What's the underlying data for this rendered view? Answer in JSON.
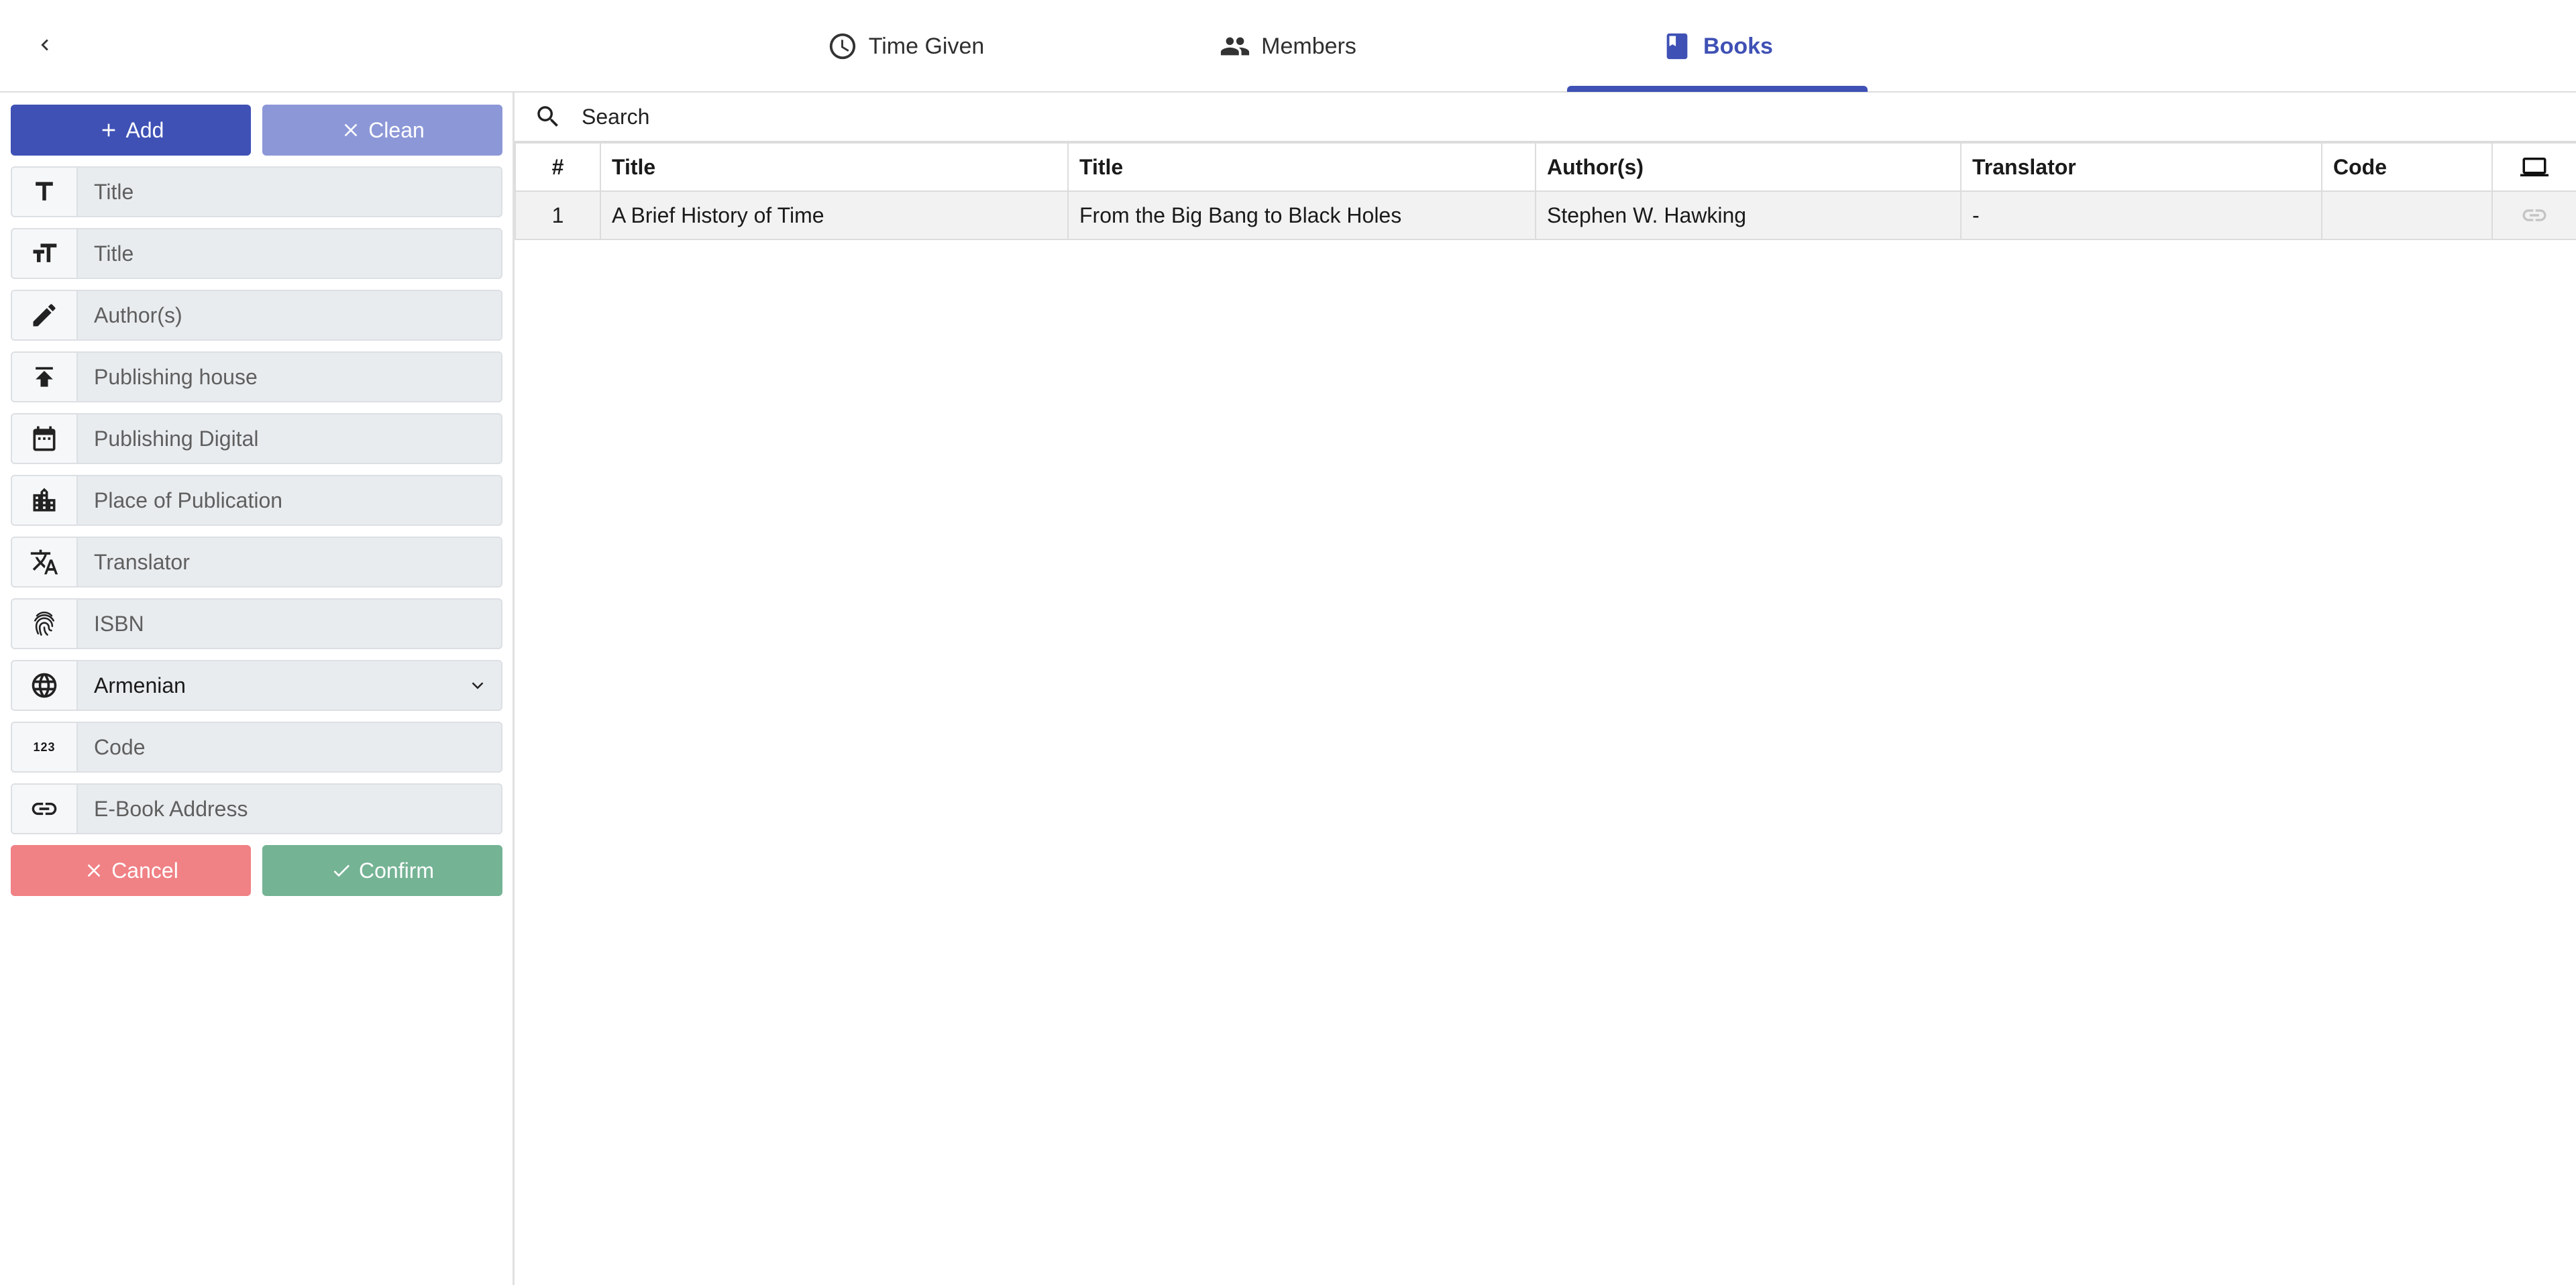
{
  "header": {
    "tabs": [
      {
        "label": "Time Given",
        "icon": "clock-icon",
        "active": false
      },
      {
        "label": "Members",
        "icon": "people-icon",
        "active": false
      },
      {
        "label": "Books",
        "icon": "book-icon",
        "active": true
      }
    ],
    "accent_color": "#3f51b5"
  },
  "form": {
    "add_label": "Add",
    "clean_label": "Clean",
    "cancel_label": "Cancel",
    "confirm_label": "Confirm",
    "fields": [
      {
        "placeholder": "Title",
        "icon": "text-title-icon"
      },
      {
        "placeholder": "Title",
        "icon": "text-size-icon"
      },
      {
        "placeholder": "Author(s)",
        "icon": "pencil-icon"
      },
      {
        "placeholder": "Publishing house",
        "icon": "publish-icon"
      },
      {
        "placeholder": "Publishing Digital",
        "icon": "calendar-icon"
      },
      {
        "placeholder": "Place of Publication",
        "icon": "city-icon"
      },
      {
        "placeholder": "Translator",
        "icon": "translate-icon"
      },
      {
        "placeholder": "ISBN",
        "icon": "fingerprint-icon"
      }
    ],
    "language": {
      "value": "Armenian",
      "icon": "globe-icon"
    },
    "code": {
      "placeholder": "Code",
      "icon": "numbers-icon",
      "glyph": "123"
    },
    "ebook": {
      "placeholder": "E-Book Address",
      "icon": "link-icon"
    },
    "colors": {
      "add": "#3f51b5",
      "clean": "#8c97d7",
      "cancel": "#f08185",
      "confirm": "#74b394"
    }
  },
  "search": {
    "placeholder": "Search"
  },
  "table": {
    "headers": [
      "#",
      "Title",
      "Title",
      "Author(s)",
      "Translator",
      "Code",
      "laptop-icon"
    ],
    "rows": [
      {
        "num": "1",
        "title": "A Brief History of Time",
        "subtitle": "From the Big Bang to Black Holes",
        "authors": "Stephen W. Hawking",
        "translator": "-",
        "code": "",
        "link": "link-icon"
      }
    ]
  }
}
